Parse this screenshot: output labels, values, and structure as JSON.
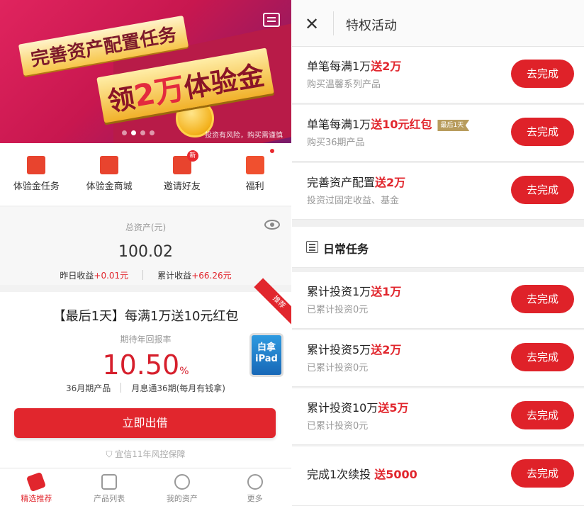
{
  "left": {
    "banner": {
      "line1": "完善资产配置任务",
      "line2_pre": "领",
      "line2_big": "2万",
      "line2_post": "体验金",
      "note": "投资有风险，购买需谨慎"
    },
    "menu": [
      {
        "label": "体验金任务"
      },
      {
        "label": "体验金商城"
      },
      {
        "label": "邀请好友",
        "badge": "新"
      },
      {
        "label": "福利"
      }
    ],
    "assets": {
      "caption": "总资产(元)",
      "value": "100.02",
      "yesterday_label": "昨日收益",
      "yesterday_value": "+0.01元",
      "total_label": "累计收益",
      "total_value": "+66.26元"
    },
    "product": {
      "ribbon": "推荐",
      "title": "【最后1天】每满1万送10元红包",
      "rate_caption": "期待年回报率",
      "rate": "10.50",
      "rate_unit": "%",
      "term": "36月期产品",
      "name": "月息通36期(每月有钱拿)",
      "promo_line1": "白拿",
      "promo_line2": "iPad",
      "cta": "立即出借",
      "guarantee": "宜信11年风控保障"
    },
    "tabs": [
      {
        "label": "精选推荐",
        "active": true
      },
      {
        "label": "产品列表"
      },
      {
        "label": "我的资产"
      },
      {
        "label": "更多"
      }
    ]
  },
  "right": {
    "header": {
      "close": "✕",
      "title": "特权活动"
    },
    "tasks_top": [
      {
        "name": "单笔每满1万",
        "reward": "送2万",
        "desc": "购买温馨系列产品",
        "button": "去完成"
      },
      {
        "name": "单笔每满1万",
        "reward": "送10元红包",
        "tag": "最后1天",
        "desc": "购买36期产品",
        "button": "去完成"
      },
      {
        "name": "完善资产配置",
        "reward": "送2万",
        "desc": "投资过固定收益、基金",
        "button": "去完成"
      }
    ],
    "daily_title": "日常任务",
    "tasks_daily": [
      {
        "name": "累计投资1万",
        "reward": "送1万",
        "desc": "已累计投资0元",
        "button": "去完成"
      },
      {
        "name": "累计投资5万",
        "reward": "送2万",
        "desc": "已累计投资0元",
        "button": "去完成"
      },
      {
        "name": "累计投资10万",
        "reward": "送5万",
        "desc": "已累计投资0元",
        "button": "去完成"
      },
      {
        "name": "完成1次续投",
        "reward": "送5000",
        "desc": "",
        "button": "去完成"
      }
    ]
  },
  "colors": {
    "accent": "#e1262d",
    "gold": "#b89c5d"
  }
}
